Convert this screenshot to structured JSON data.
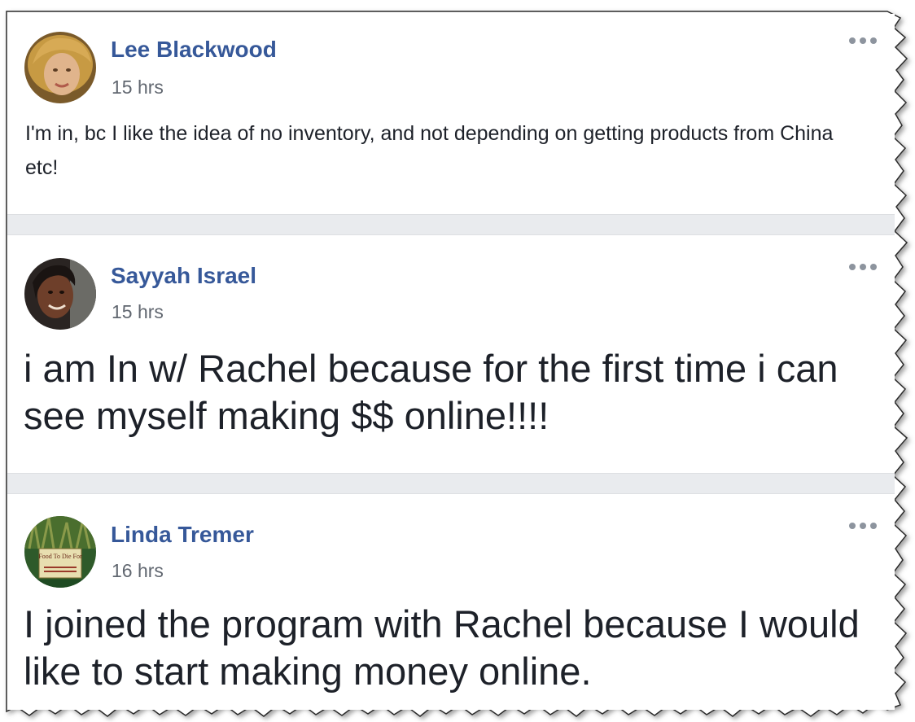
{
  "posts": [
    {
      "author": "Lee Blackwood",
      "time": "15 hrs",
      "text": "I'm in, bc I like the idea of no inventory, and not depending on getting products from China etc!",
      "avatar_icon": "profile-photo-icon"
    },
    {
      "author": "Sayyah Israel",
      "time": "15 hrs",
      "text": "i am In w/ Rachel because for the first time i can see myself making $$ online!!!!",
      "avatar_icon": "profile-photo-icon"
    },
    {
      "author": "Linda Tremer",
      "time": "16 hrs",
      "text": "I joined the program with Rachel because I would like to start making money online.",
      "avatar_icon": "book-cover-icon",
      "avatar_text": "Food To Die For"
    }
  ],
  "colors": {
    "author_link": "#365899",
    "timestamp": "#616770",
    "body_text": "#1d2129",
    "divider": "#e9ebee",
    "more_dots": "#8d949e"
  },
  "icons": {
    "more": "more-options-icon"
  }
}
